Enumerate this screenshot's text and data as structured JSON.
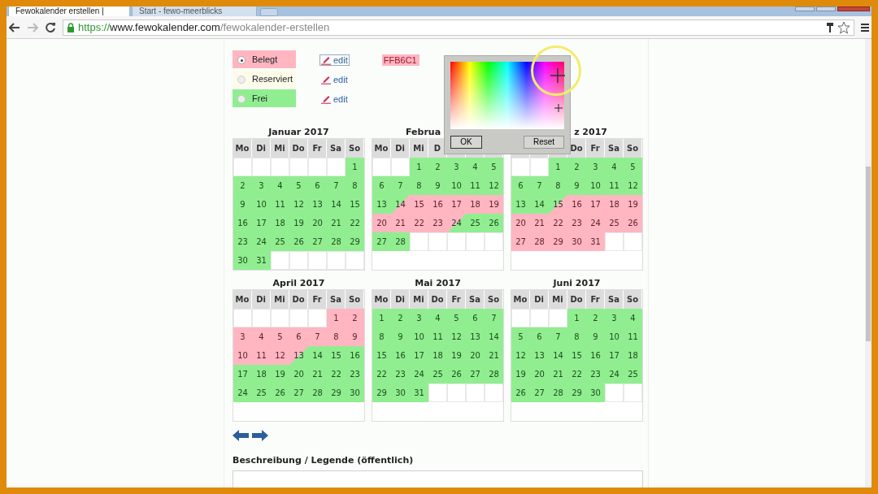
{
  "browser": {
    "tabs": [
      {
        "title": "Fewokalender erstellen |",
        "selected": true
      },
      {
        "title": "Start - fewo-meerblicks",
        "selected": false
      }
    ],
    "address": {
      "scheme": "https://",
      "host": "www.fewokalender.com",
      "path": "/fewokalender-erstellen"
    }
  },
  "legend": [
    {
      "label": "Belegt",
      "color": "#ffb6c1",
      "selected": true,
      "edit": "edit",
      "focused": true
    },
    {
      "label": "Reserviert",
      "color": "#fdfbea",
      "selected": false,
      "edit": "edit",
      "focused": false
    },
    {
      "label": "Frei",
      "color": "#90ee90",
      "selected": false,
      "edit": "edit",
      "focused": false
    }
  ],
  "hex_value": "FFB6C1",
  "color_picker": {
    "ok": "OK",
    "reset": "Reset"
  },
  "months": [
    {
      "title": "Januar 2017",
      "weekdays": [
        "Mo",
        "Di",
        "Mi",
        "Do",
        "Fr",
        "Sa",
        "So"
      ],
      "weeks": [
        [
          {
            "kind": "empty"
          },
          {
            "kind": "empty"
          },
          {
            "kind": "empty"
          },
          {
            "kind": "empty"
          },
          {
            "kind": "empty"
          },
          {
            "kind": "empty"
          },
          {
            "day": "1",
            "kind": "free"
          }
        ],
        [
          {
            "day": "2",
            "kind": "free"
          },
          {
            "day": "3",
            "kind": "free"
          },
          {
            "day": "4",
            "kind": "free"
          },
          {
            "day": "5",
            "kind": "free"
          },
          {
            "day": "6",
            "kind": "free"
          },
          {
            "day": "7",
            "kind": "free"
          },
          {
            "day": "8",
            "kind": "free"
          }
        ],
        [
          {
            "day": "9",
            "kind": "free"
          },
          {
            "day": "10",
            "kind": "free"
          },
          {
            "day": "11",
            "kind": "free"
          },
          {
            "day": "12",
            "kind": "free"
          },
          {
            "day": "13",
            "kind": "free"
          },
          {
            "day": "14",
            "kind": "free"
          },
          {
            "day": "15",
            "kind": "free"
          }
        ],
        [
          {
            "day": "16",
            "kind": "free"
          },
          {
            "day": "17",
            "kind": "free"
          },
          {
            "day": "18",
            "kind": "free"
          },
          {
            "day": "19",
            "kind": "free"
          },
          {
            "day": "20",
            "kind": "free"
          },
          {
            "day": "21",
            "kind": "free"
          },
          {
            "day": "22",
            "kind": "free"
          }
        ],
        [
          {
            "day": "23",
            "kind": "free"
          },
          {
            "day": "24",
            "kind": "free"
          },
          {
            "day": "25",
            "kind": "free"
          },
          {
            "day": "26",
            "kind": "free"
          },
          {
            "day": "27",
            "kind": "free"
          },
          {
            "day": "28",
            "kind": "free"
          },
          {
            "day": "29",
            "kind": "free"
          }
        ],
        [
          {
            "day": "30",
            "kind": "free"
          },
          {
            "day": "31",
            "kind": "free"
          },
          {
            "kind": "empty"
          },
          {
            "kind": "empty"
          },
          {
            "kind": "empty"
          },
          {
            "kind": "empty"
          },
          {
            "kind": "empty"
          }
        ]
      ]
    },
    {
      "title": "Februa",
      "weekdays": [
        "Mo",
        "Di",
        "Mi",
        "D"
      ],
      "weeks": [
        [
          {
            "kind": "empty"
          },
          {
            "kind": "empty"
          },
          {
            "day": "1",
            "kind": "free"
          },
          {
            "day": "2",
            "kind": "free"
          },
          {
            "day": "3",
            "kind": "free"
          },
          {
            "day": "4",
            "kind": "free"
          },
          {
            "day": "5",
            "kind": "free"
          }
        ],
        [
          {
            "day": "6",
            "kind": "free"
          },
          {
            "day": "7",
            "kind": "free"
          },
          {
            "day": "8",
            "kind": "free"
          },
          {
            "day": "9",
            "kind": "free"
          },
          {
            "day": "10",
            "kind": "free"
          },
          {
            "day": "11",
            "kind": "free"
          },
          {
            "day": "12",
            "kind": "free"
          }
        ],
        [
          {
            "day": "13",
            "kind": "free"
          },
          {
            "day": "14",
            "kind": "arrival"
          },
          {
            "day": "15",
            "kind": "booked"
          },
          {
            "day": "16",
            "kind": "booked"
          },
          {
            "day": "17",
            "kind": "booked"
          },
          {
            "day": "18",
            "kind": "booked"
          },
          {
            "day": "19",
            "kind": "booked"
          }
        ],
        [
          {
            "day": "20",
            "kind": "booked"
          },
          {
            "day": "21",
            "kind": "booked"
          },
          {
            "day": "22",
            "kind": "booked"
          },
          {
            "day": "23",
            "kind": "booked"
          },
          {
            "day": "24",
            "kind": "departure"
          },
          {
            "day": "25",
            "kind": "free"
          },
          {
            "day": "26",
            "kind": "free"
          }
        ],
        [
          {
            "day": "27",
            "kind": "free"
          },
          {
            "day": "28",
            "kind": "free"
          },
          {
            "kind": "empty"
          },
          {
            "kind": "empty"
          },
          {
            "kind": "empty"
          },
          {
            "kind": "empty"
          },
          {
            "kind": "empty"
          }
        ]
      ]
    },
    {
      "title": "z 2017",
      "weekdays_right": [
        "Do",
        "Fr",
        "Sa",
        "So"
      ],
      "weeks": [
        [
          {
            "kind": "empty"
          },
          {
            "kind": "empty"
          },
          {
            "day": "1",
            "kind": "free"
          },
          {
            "day": "2",
            "kind": "free"
          },
          {
            "day": "3",
            "kind": "free"
          },
          {
            "day": "4",
            "kind": "free"
          },
          {
            "day": "5",
            "kind": "free"
          }
        ],
        [
          {
            "day": "6",
            "kind": "free"
          },
          {
            "day": "7",
            "kind": "free"
          },
          {
            "day": "8",
            "kind": "free"
          },
          {
            "day": "9",
            "kind": "free"
          },
          {
            "day": "10",
            "kind": "free"
          },
          {
            "day": "11",
            "kind": "free"
          },
          {
            "day": "12",
            "kind": "free"
          }
        ],
        [
          {
            "day": "13",
            "kind": "free"
          },
          {
            "day": "14",
            "kind": "free"
          },
          {
            "day": "15",
            "kind": "arrival"
          },
          {
            "day": "16",
            "kind": "booked"
          },
          {
            "day": "17",
            "kind": "booked"
          },
          {
            "day": "18",
            "kind": "booked"
          },
          {
            "day": "19",
            "kind": "booked"
          }
        ],
        [
          {
            "day": "20",
            "kind": "booked"
          },
          {
            "day": "21",
            "kind": "booked"
          },
          {
            "day": "22",
            "kind": "booked"
          },
          {
            "day": "23",
            "kind": "booked"
          },
          {
            "day": "24",
            "kind": "booked"
          },
          {
            "day": "25",
            "kind": "booked"
          },
          {
            "day": "26",
            "kind": "booked"
          }
        ],
        [
          {
            "day": "27",
            "kind": "booked"
          },
          {
            "day": "28",
            "kind": "booked"
          },
          {
            "day": "29",
            "kind": "booked"
          },
          {
            "day": "30",
            "kind": "booked"
          },
          {
            "day": "31",
            "kind": "booked"
          },
          {
            "kind": "empty"
          },
          {
            "kind": "empty"
          }
        ]
      ]
    },
    {
      "title": "April 2017",
      "weekdays": [
        "Mo",
        "Di",
        "Mi",
        "Do",
        "Fr",
        "Sa",
        "So"
      ],
      "weeks": [
        [
          {
            "kind": "empty"
          },
          {
            "kind": "empty"
          },
          {
            "kind": "empty"
          },
          {
            "kind": "empty"
          },
          {
            "kind": "empty"
          },
          {
            "day": "1",
            "kind": "booked"
          },
          {
            "day": "2",
            "kind": "booked"
          }
        ],
        [
          {
            "day": "3",
            "kind": "booked"
          },
          {
            "day": "4",
            "kind": "booked"
          },
          {
            "day": "5",
            "kind": "booked"
          },
          {
            "day": "6",
            "kind": "booked"
          },
          {
            "day": "7",
            "kind": "booked"
          },
          {
            "day": "8",
            "kind": "booked"
          },
          {
            "day": "9",
            "kind": "booked"
          }
        ],
        [
          {
            "day": "10",
            "kind": "booked"
          },
          {
            "day": "11",
            "kind": "booked"
          },
          {
            "day": "12",
            "kind": "booked"
          },
          {
            "day": "13",
            "kind": "departure"
          },
          {
            "day": "14",
            "kind": "free"
          },
          {
            "day": "15",
            "kind": "free"
          },
          {
            "day": "16",
            "kind": "free"
          }
        ],
        [
          {
            "day": "17",
            "kind": "free"
          },
          {
            "day": "18",
            "kind": "free"
          },
          {
            "day": "19",
            "kind": "free"
          },
          {
            "day": "20",
            "kind": "free"
          },
          {
            "day": "21",
            "kind": "free"
          },
          {
            "day": "22",
            "kind": "free"
          },
          {
            "day": "23",
            "kind": "free"
          }
        ],
        [
          {
            "day": "24",
            "kind": "free"
          },
          {
            "day": "25",
            "kind": "free"
          },
          {
            "day": "26",
            "kind": "free"
          },
          {
            "day": "27",
            "kind": "free"
          },
          {
            "day": "28",
            "kind": "free"
          },
          {
            "day": "29",
            "kind": "free"
          },
          {
            "day": "30",
            "kind": "free"
          }
        ]
      ]
    },
    {
      "title": "Mai 2017",
      "weekdays": [
        "Mo",
        "Di",
        "Mi",
        "Do",
        "Fr",
        "Sa",
        "So"
      ],
      "weeks": [
        [
          {
            "day": "1",
            "kind": "free"
          },
          {
            "day": "2",
            "kind": "free"
          },
          {
            "day": "3",
            "kind": "free"
          },
          {
            "day": "4",
            "kind": "free"
          },
          {
            "day": "5",
            "kind": "free"
          },
          {
            "day": "6",
            "kind": "free"
          },
          {
            "day": "7",
            "kind": "free"
          }
        ],
        [
          {
            "day": "8",
            "kind": "free"
          },
          {
            "day": "9",
            "kind": "free"
          },
          {
            "day": "10",
            "kind": "free"
          },
          {
            "day": "11",
            "kind": "free"
          },
          {
            "day": "12",
            "kind": "free"
          },
          {
            "day": "13",
            "kind": "free"
          },
          {
            "day": "14",
            "kind": "free"
          }
        ],
        [
          {
            "day": "15",
            "kind": "free"
          },
          {
            "day": "16",
            "kind": "free"
          },
          {
            "day": "17",
            "kind": "free"
          },
          {
            "day": "18",
            "kind": "free"
          },
          {
            "day": "19",
            "kind": "free"
          },
          {
            "day": "20",
            "kind": "free"
          },
          {
            "day": "21",
            "kind": "free"
          }
        ],
        [
          {
            "day": "22",
            "kind": "free"
          },
          {
            "day": "23",
            "kind": "free"
          },
          {
            "day": "24",
            "kind": "free"
          },
          {
            "day": "25",
            "kind": "free"
          },
          {
            "day": "26",
            "kind": "free"
          },
          {
            "day": "27",
            "kind": "free"
          },
          {
            "day": "28",
            "kind": "free"
          }
        ],
        [
          {
            "day": "29",
            "kind": "free"
          },
          {
            "day": "30",
            "kind": "free"
          },
          {
            "day": "31",
            "kind": "free"
          },
          {
            "kind": "empty"
          },
          {
            "kind": "empty"
          },
          {
            "kind": "empty"
          },
          {
            "kind": "empty"
          }
        ]
      ]
    },
    {
      "title": "Juni 2017",
      "weekdays": [
        "Mo",
        "Di",
        "Mi",
        "Do",
        "Fr",
        "Sa",
        "So"
      ],
      "weeks": [
        [
          {
            "kind": "empty"
          },
          {
            "kind": "empty"
          },
          {
            "kind": "empty"
          },
          {
            "day": "1",
            "kind": "free"
          },
          {
            "day": "2",
            "kind": "free"
          },
          {
            "day": "3",
            "kind": "free"
          },
          {
            "day": "4",
            "kind": "free"
          }
        ],
        [
          {
            "day": "5",
            "kind": "free"
          },
          {
            "day": "6",
            "kind": "free"
          },
          {
            "day": "7",
            "kind": "free"
          },
          {
            "day": "8",
            "kind": "free"
          },
          {
            "day": "9",
            "kind": "free"
          },
          {
            "day": "10",
            "kind": "free"
          },
          {
            "day": "11",
            "kind": "free"
          }
        ],
        [
          {
            "day": "12",
            "kind": "free"
          },
          {
            "day": "13",
            "kind": "free"
          },
          {
            "day": "14",
            "kind": "free"
          },
          {
            "day": "15",
            "kind": "free"
          },
          {
            "day": "16",
            "kind": "free"
          },
          {
            "day": "17",
            "kind": "free"
          },
          {
            "day": "18",
            "kind": "free"
          }
        ],
        [
          {
            "day": "19",
            "kind": "free"
          },
          {
            "day": "20",
            "kind": "free"
          },
          {
            "day": "21",
            "kind": "free"
          },
          {
            "day": "22",
            "kind": "free"
          },
          {
            "day": "23",
            "kind": "free"
          },
          {
            "day": "24",
            "kind": "free"
          },
          {
            "day": "25",
            "kind": "free"
          }
        ],
        [
          {
            "day": "26",
            "kind": "free"
          },
          {
            "day": "27",
            "kind": "free"
          },
          {
            "day": "28",
            "kind": "free"
          },
          {
            "day": "29",
            "kind": "free"
          },
          {
            "day": "30",
            "kind": "free"
          },
          {
            "kind": "empty"
          },
          {
            "kind": "empty"
          }
        ]
      ]
    }
  ],
  "description_label": "Beschreibung / Legende (öffentlich)"
}
